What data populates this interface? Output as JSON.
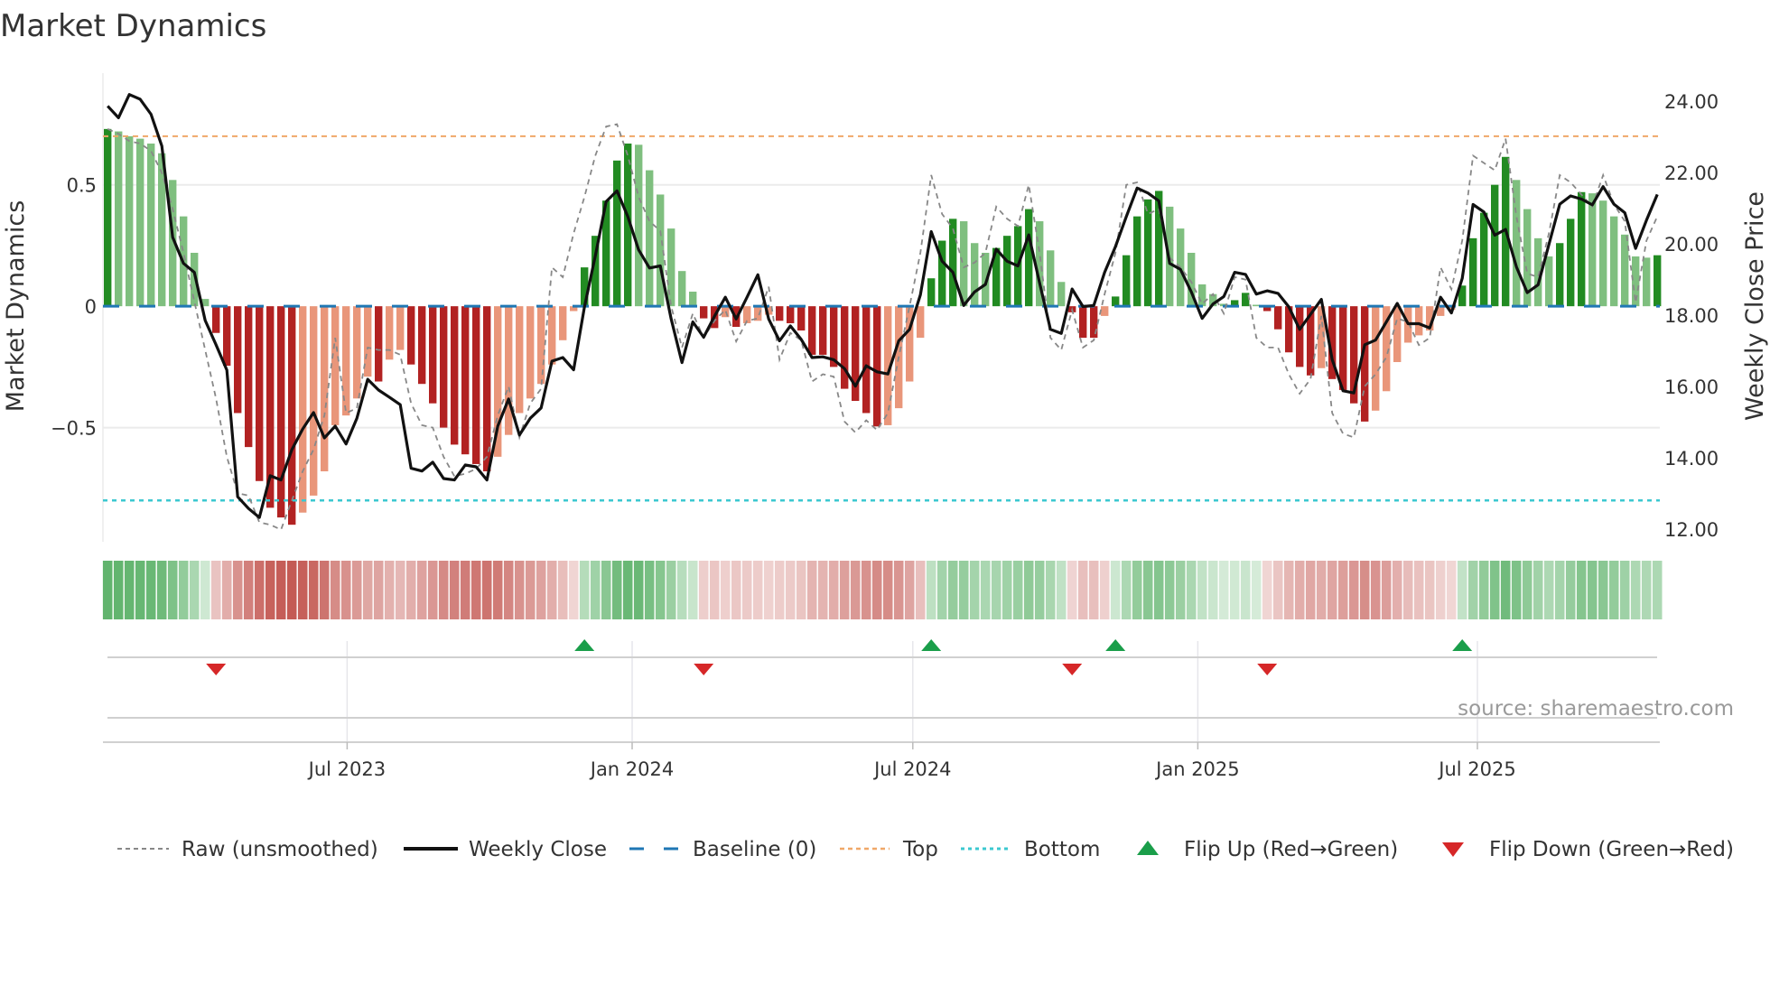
{
  "title": "Market Dynamics",
  "source_note": "source: sharemaestro.com",
  "colors": {
    "pos_rising": "#228b22",
    "pos_falling": "#7fbf7f",
    "neg_falling": "#b22222",
    "neg_rising": "#e9967a",
    "baseline": "#1f77b4",
    "top": "#f0a868",
    "bottom": "#3cc8d0",
    "raw": "#888888",
    "close": "#111111",
    "flip_up": "#1a9e4a",
    "flip_down": "#d62728",
    "strip_green": "#4caa5a",
    "strip_red": "#c45a54"
  },
  "legend": [
    {
      "key": "raw",
      "label": "Raw (unsmoothed)"
    },
    {
      "key": "close",
      "label": "Weekly Close"
    },
    {
      "key": "baseline",
      "label": "Baseline (0)"
    },
    {
      "key": "top",
      "label": "Top"
    },
    {
      "key": "bottom",
      "label": "Bottom"
    },
    {
      "key": "flip_up",
      "label": "Flip Up (Red→Green)"
    },
    {
      "key": "flip_down",
      "label": "Flip Down (Green→Red)"
    }
  ],
  "chart_data": {
    "type": "bar",
    "title": "Market Dynamics",
    "xlabel": "",
    "ylabel": "Market Dynamics",
    "y2label": "Weekly Close Price",
    "ylim": [
      -0.97,
      0.96
    ],
    "y2lim": [
      11.65,
      24.78
    ],
    "yticks": [
      {
        "v": 0.5,
        "label": "0.5"
      },
      {
        "v": 0,
        "label": "0"
      },
      {
        "v": -0.5,
        "label": "−0.5"
      }
    ],
    "y2ticks": [
      "24.00",
      "22.00",
      "20.00",
      "18.00",
      "16.00",
      "14.00",
      "12.00"
    ],
    "y2tick_values": [
      24,
      22,
      20,
      18,
      16,
      14,
      12
    ],
    "xticks": [
      {
        "week": 22.1,
        "label": "Jul 2023"
      },
      {
        "week": 48.4,
        "label": "Jan 2024"
      },
      {
        "week": 74.3,
        "label": "Jul 2024"
      },
      {
        "week": 100.6,
        "label": "Jan 2025"
      },
      {
        "week": 126.4,
        "label": "Jul 2025"
      }
    ],
    "top_level": 0.7,
    "bottom_level": -0.8,
    "baseline": 0,
    "grid": true,
    "legend_position": "bottom",
    "dynamics": [
      0.73,
      0.72,
      0.7,
      0.69,
      0.67,
      0.63,
      0.52,
      0.37,
      0.22,
      0.03,
      -0.11,
      -0.245,
      -0.44,
      -0.58,
      -0.72,
      -0.83,
      -0.87,
      -0.9,
      -0.85,
      -0.78,
      -0.68,
      -0.49,
      -0.45,
      -0.38,
      -0.29,
      -0.31,
      -0.22,
      -0.18,
      -0.24,
      -0.32,
      -0.4,
      -0.5,
      -0.57,
      -0.61,
      -0.65,
      -0.68,
      -0.62,
      -0.53,
      -0.44,
      -0.38,
      -0.32,
      -0.24,
      -0.14,
      -0.02,
      0.16,
      0.29,
      0.435,
      0.6,
      0.67,
      0.665,
      0.56,
      0.46,
      0.32,
      0.145,
      0.06,
      -0.05,
      -0.09,
      -0.045,
      -0.085,
      -0.07,
      -0.06,
      -0.035,
      -0.06,
      -0.07,
      -0.1,
      -0.2,
      -0.2,
      -0.25,
      -0.34,
      -0.39,
      -0.44,
      -0.495,
      -0.49,
      -0.42,
      -0.31,
      -0.13,
      0.115,
      0.27,
      0.36,
      0.35,
      0.26,
      0.22,
      0.24,
      0.29,
      0.33,
      0.4,
      0.35,
      0.23,
      0.1,
      -0.025,
      -0.13,
      -0.13,
      -0.04,
      0.04,
      0.21,
      0.37,
      0.44,
      0.475,
      0.41,
      0.32,
      0.22,
      0.09,
      0.05,
      0.01,
      0.025,
      0.055,
      0.006,
      -0.02,
      -0.095,
      -0.19,
      -0.25,
      -0.285,
      -0.255,
      -0.3,
      -0.345,
      -0.4,
      -0.475,
      -0.43,
      -0.35,
      -0.23,
      -0.15,
      -0.12,
      -0.1,
      -0.04,
      -0.015,
      0.085,
      0.28,
      0.385,
      0.5,
      0.615,
      0.52,
      0.4,
      0.28,
      0.205,
      0.26,
      0.36,
      0.47,
      0.465,
      0.435,
      0.37,
      0.295,
      0.205,
      0.2,
      0.21
    ],
    "raw": [
      0.73,
      0.71,
      0.68,
      0.67,
      0.64,
      0.55,
      0.4,
      0.22,
      0.02,
      -0.18,
      -0.38,
      -0.62,
      -0.77,
      -0.78,
      -0.89,
      -0.9,
      -0.92,
      -0.8,
      -0.68,
      -0.59,
      -0.45,
      -0.13,
      -0.44,
      -0.42,
      -0.17,
      -0.18,
      -0.18,
      -0.2,
      -0.4,
      -0.49,
      -0.5,
      -0.62,
      -0.7,
      -0.69,
      -0.67,
      -0.62,
      -0.45,
      -0.33,
      -0.54,
      -0.4,
      -0.34,
      0.16,
      0.12,
      0.3,
      0.45,
      0.62,
      0.74,
      0.75,
      0.62,
      0.45,
      0.35,
      0.31,
      0.0,
      -0.17,
      -0.03,
      -0.13,
      -0.06,
      -0.015,
      -0.145,
      -0.06,
      -0.05,
      0.08,
      -0.22,
      -0.11,
      -0.14,
      -0.31,
      -0.28,
      -0.29,
      -0.475,
      -0.52,
      -0.47,
      -0.51,
      -0.44,
      -0.21,
      0.0,
      0.22,
      0.54,
      0.38,
      0.32,
      0.16,
      0.18,
      0.22,
      0.41,
      0.36,
      0.33,
      0.5,
      0.22,
      -0.13,
      -0.18,
      -0.015,
      -0.17,
      -0.14,
      0.05,
      0.22,
      0.5,
      0.51,
      0.38,
      0.4,
      0.2,
      0.16,
      0.1,
      0.01,
      0.05,
      -0.03,
      0.12,
      0.11,
      -0.13,
      -0.17,
      -0.17,
      -0.28,
      -0.36,
      -0.3,
      -0.04,
      -0.44,
      -0.525,
      -0.54,
      -0.33,
      -0.28,
      -0.21,
      -0.05,
      -0.065,
      -0.16,
      -0.13,
      0.16,
      0.07,
      0.27,
      0.62,
      0.59,
      0.56,
      0.69,
      0.37,
      0.135,
      0.12,
      0.3,
      0.54,
      0.51,
      0.46,
      0.41,
      0.54,
      0.42,
      0.35,
      0.015,
      0.27,
      0.37
    ],
    "weekly_close": [
      23.86,
      23.53,
      24.18,
      24.05,
      23.63,
      22.74,
      20.18,
      19.45,
      19.2,
      17.85,
      17.17,
      16.46,
      12.91,
      12.58,
      12.33,
      13.5,
      13.38,
      14.23,
      14.81,
      15.27,
      14.56,
      14.89,
      14.39,
      15.11,
      16.2,
      15.9,
      15.7,
      15.49,
      13.71,
      13.63,
      13.88,
      13.42,
      13.38,
      13.8,
      13.75,
      13.38,
      14.89,
      15.65,
      14.64,
      15.11,
      15.4,
      16.71,
      16.81,
      16.47,
      18.23,
      19.66,
      21.18,
      21.48,
      20.76,
      19.83,
      19.32,
      19.38,
      17.89,
      16.67,
      17.81,
      17.38,
      17.97,
      18.5,
      17.89,
      18.5,
      19.13,
      17.89,
      17.28,
      17.7,
      17.32,
      16.81,
      16.83,
      16.75,
      16.5,
      16.01,
      16.58,
      16.41,
      16.35,
      17.28,
      17.6,
      18.57,
      20.34,
      19.51,
      19.2,
      18.27,
      18.65,
      18.86,
      19.85,
      19.51,
      19.38,
      20.25,
      18.9,
      17.6,
      17.49,
      18.73,
      18.24,
      18.27,
      19.2,
      19.92,
      20.76,
      21.56,
      21.42,
      21.2,
      19.45,
      19.28,
      18.65,
      17.91,
      18.31,
      18.52,
      19.2,
      19.14,
      18.59,
      18.68,
      18.61,
      18.23,
      17.6,
      18.02,
      18.44,
      16.75,
      15.88,
      15.82,
      17.17,
      17.3,
      17.81,
      18.33,
      17.76,
      17.76,
      17.64,
      18.5,
      18.06,
      19.03,
      21.1,
      20.89,
      20.24,
      20.4,
      19.35,
      18.63,
      18.85,
      19.98,
      21.11,
      21.34,
      21.25,
      21.09,
      21.6,
      21.11,
      20.87,
      19.87,
      20.66,
      21.38
    ],
    "flips": [
      {
        "week": 10,
        "direction": "down"
      },
      {
        "week": 44,
        "direction": "up"
      },
      {
        "week": 55,
        "direction": "down"
      },
      {
        "week": 76,
        "direction": "up"
      },
      {
        "week": 89,
        "direction": "down"
      },
      {
        "week": 93,
        "direction": "up"
      },
      {
        "week": 107,
        "direction": "down"
      },
      {
        "week": 125,
        "direction": "up"
      }
    ]
  }
}
